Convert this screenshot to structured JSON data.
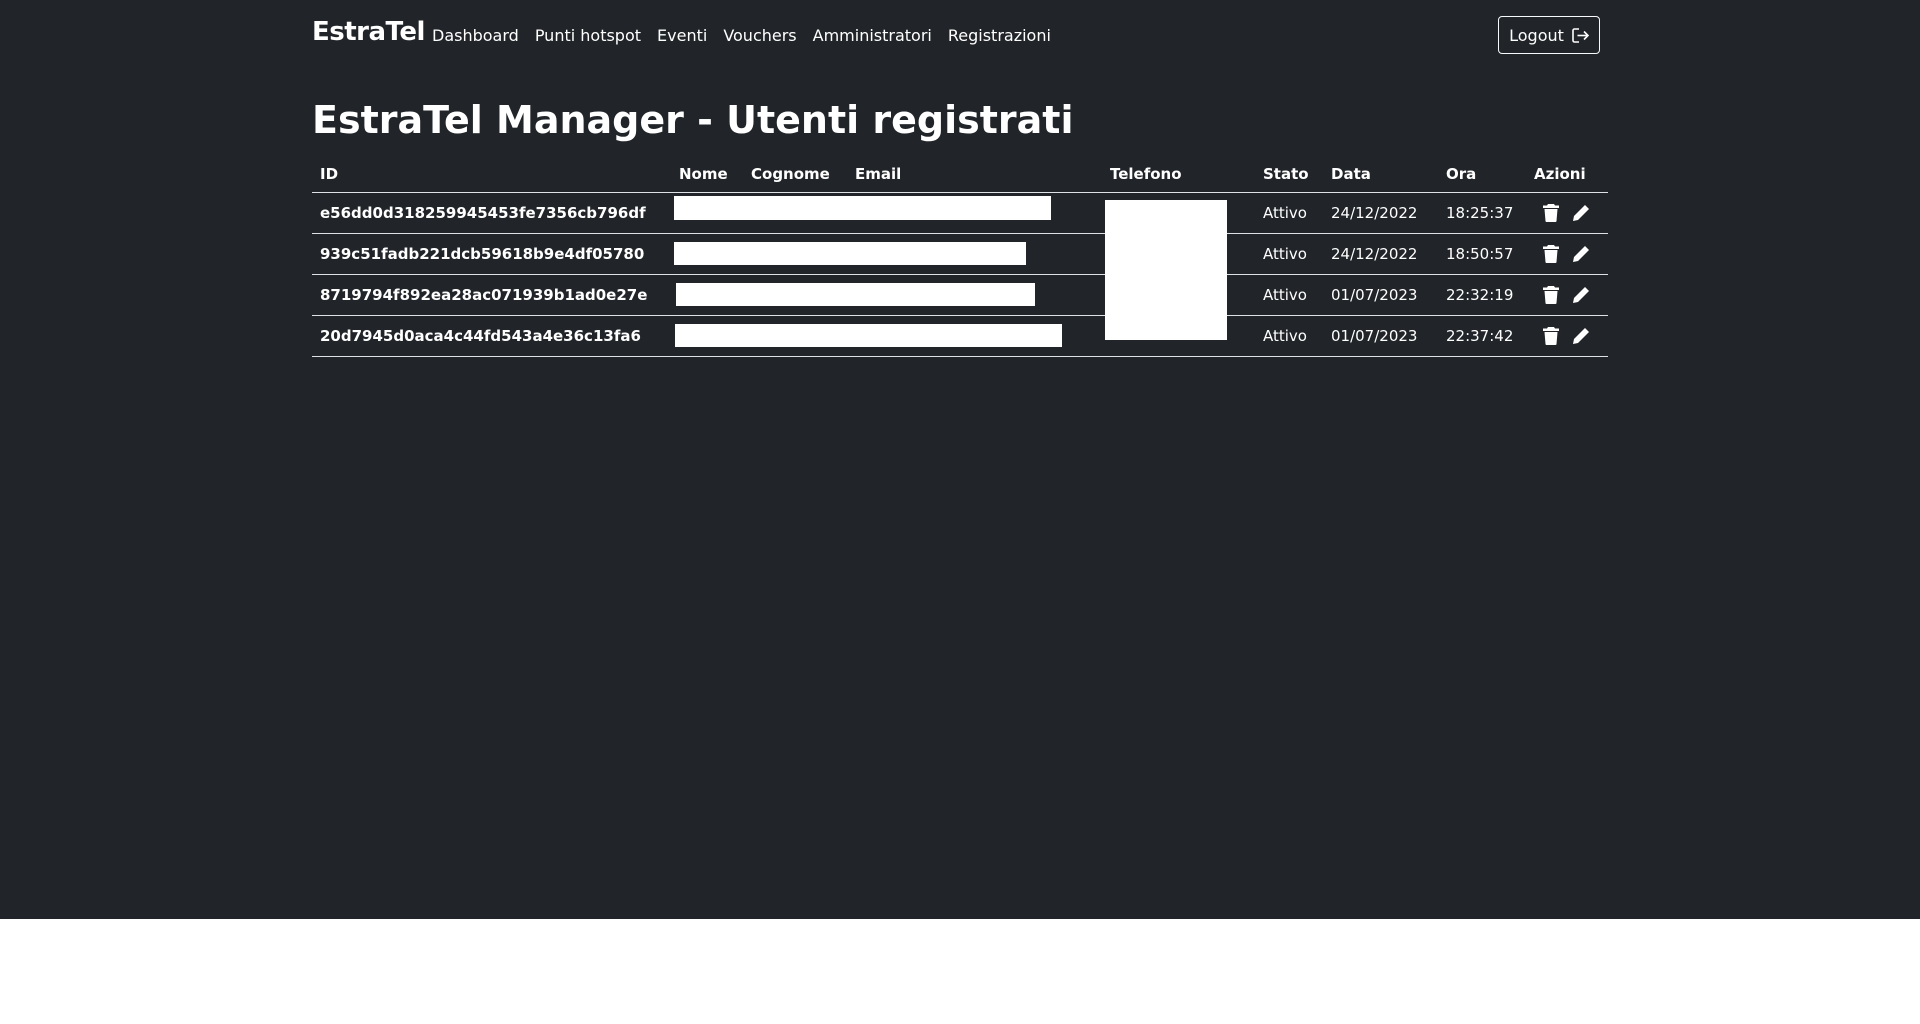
{
  "navbar": {
    "brand": "EstraTel",
    "links": [
      "Dashboard",
      "Punti hotspot",
      "Eventi",
      "Vouchers",
      "Amministratori",
      "Registrazioni"
    ],
    "logout_label": "Logout",
    "logout_icon": "logout-icon"
  },
  "page": {
    "title": "EstraTel Manager - Utenti registrati"
  },
  "table": {
    "headers": [
      "ID",
      "Nome",
      "Cognome",
      "Email",
      "Telefono",
      "Stato",
      "Data",
      "Ora",
      "Azioni"
    ],
    "rows": [
      {
        "id": "e56dd0d318259945453fe7356cb796df",
        "stato": "Attivo",
        "data": "24/12/2022",
        "ora": "18:25:37"
      },
      {
        "id": "939c51fadb221dcb59618b9e4df05780",
        "stato": "Attivo",
        "data": "24/12/2022",
        "ora": "18:50:57"
      },
      {
        "id": "8719794f892ea28ac071939b1ad0e27e",
        "stato": "Attivo",
        "data": "01/07/2023",
        "ora": "22:32:19"
      },
      {
        "id": "20d7945d0aca4c44fd543a4e36c13fa6",
        "stato": "Attivo",
        "data": "01/07/2023",
        "ora": "22:37:42"
      }
    ],
    "action_icons": [
      "trash-icon",
      "pencil-icon"
    ]
  },
  "colors": {
    "background": "#212529",
    "text": "#ffffff",
    "border": "#dee2e6"
  }
}
